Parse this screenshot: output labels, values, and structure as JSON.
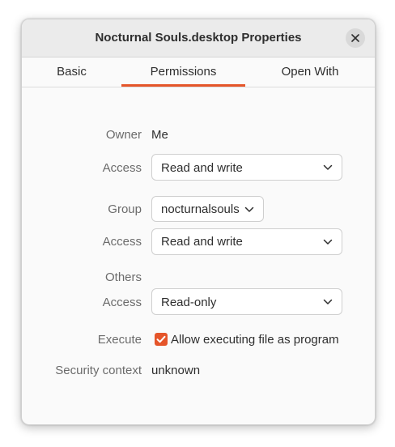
{
  "window": {
    "title": "Nocturnal Souls.desktop Properties",
    "close_icon": "close-icon"
  },
  "tabs": [
    {
      "label": "Basic",
      "active": false
    },
    {
      "label": "Permissions",
      "active": true
    },
    {
      "label": "Open With",
      "active": false
    }
  ],
  "colors": {
    "accent": "#e5552a"
  },
  "permissions": {
    "owner_label": "Owner",
    "owner_value": "Me",
    "owner_access_label": "Access",
    "owner_access_value": "Read and write",
    "group_label": "Group",
    "group_value": "nocturnalsouls",
    "group_access_label": "Access",
    "group_access_value": "Read and write",
    "others_label": "Others",
    "others_access_label": "Access",
    "others_access_value": "Read-only",
    "execute_label": "Execute",
    "execute_checkbox_label": "Allow executing file as program",
    "execute_checked": true,
    "security_label": "Security context",
    "security_value": "unknown"
  }
}
